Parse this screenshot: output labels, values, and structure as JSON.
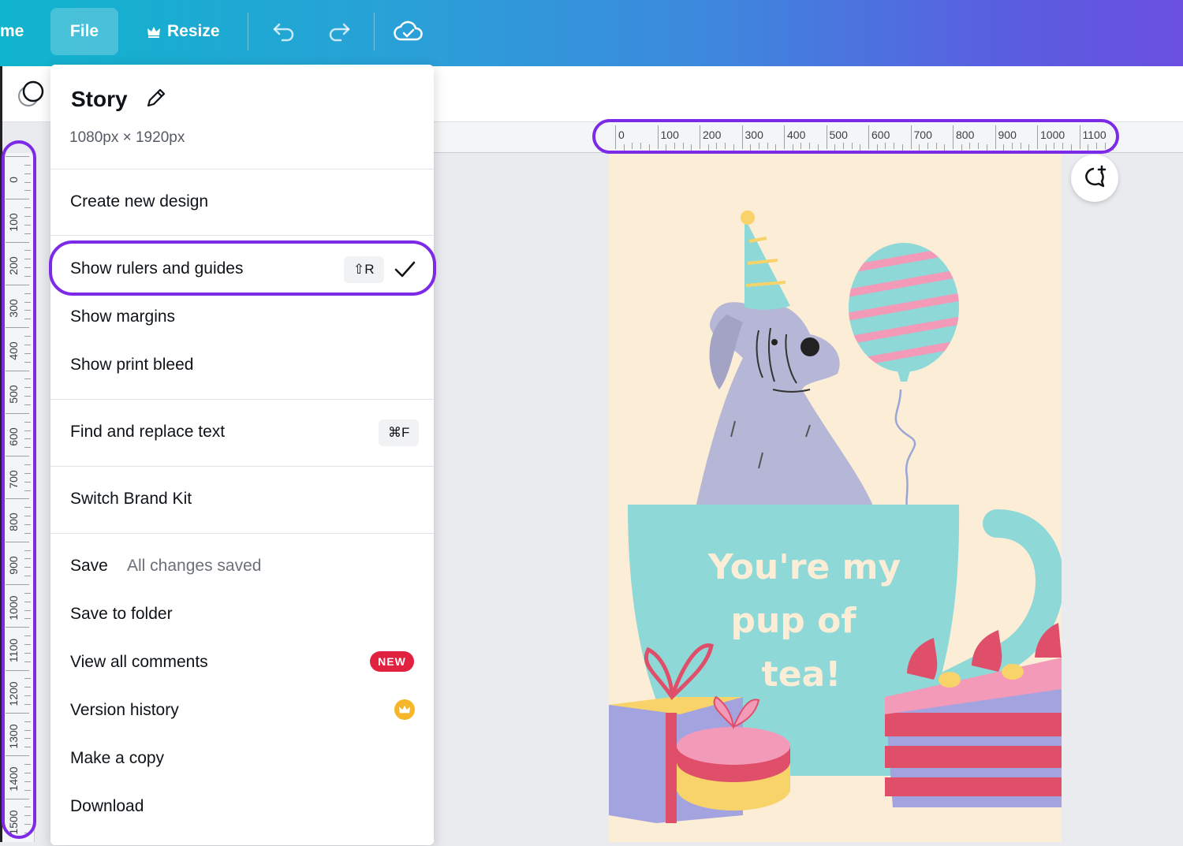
{
  "topbar": {
    "home_label": "me",
    "file_label": "File",
    "resize_label": "Resize",
    "icons": [
      "crown-icon",
      "undo-icon",
      "redo-icon",
      "cloud-saved-icon"
    ]
  },
  "menu": {
    "title": "Story",
    "dimensions": "1080px × 1920px",
    "create_new": "Create new design",
    "show_rulers": "Show rulers and guides",
    "show_rulers_shortcut": "⇧R",
    "show_margins": "Show margins",
    "show_print_bleed": "Show print bleed",
    "find_replace": "Find and replace text",
    "find_replace_shortcut": "⌘F",
    "switch_brand_kit": "Switch Brand Kit",
    "save": "Save",
    "save_status": "All changes saved",
    "save_to_folder": "Save to folder",
    "view_comments": "View all comments",
    "new_badge": "NEW",
    "version_history": "Version history",
    "make_copy": "Make a copy",
    "download": "Download"
  },
  "rulers": {
    "horizontal": [
      "0",
      "100",
      "200",
      "300",
      "400",
      "500",
      "600",
      "700",
      "800",
      "900",
      "1000",
      "1100"
    ],
    "vertical": [
      "0",
      "100",
      "200",
      "300",
      "400",
      "500",
      "600",
      "700",
      "800",
      "900",
      "1000",
      "1100",
      "1200",
      "1300",
      "1400",
      "1500"
    ]
  },
  "design": {
    "text_line1": "You're my",
    "text_line2": "pup of",
    "text_line3": "tea!",
    "colors": {
      "background": "#fbedd6",
      "cup": "#8ed8d8",
      "text": "#fbedd6",
      "accent": "#7d2ae8"
    }
  }
}
